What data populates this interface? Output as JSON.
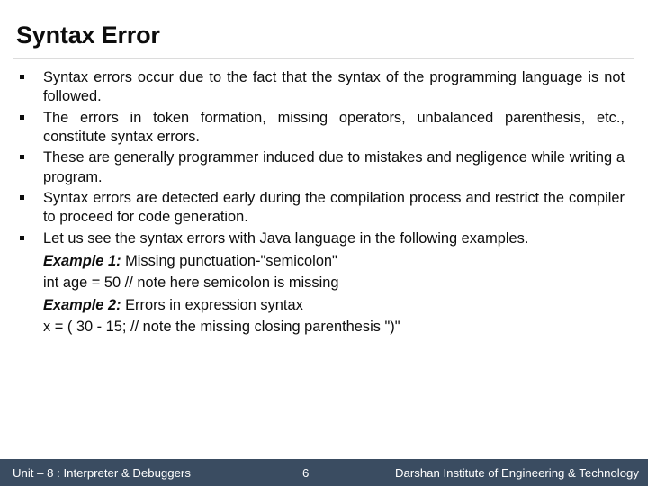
{
  "slide": {
    "title": "Syntax Error",
    "bullets": [
      "Syntax errors occur due to the fact that the syntax of the programming language is not followed.",
      "The errors in token formation, missing operators, unbalanced parenthesis, etc., constitute syntax errors.",
      "These are generally programmer induced due to mistakes and negligence while writing a program.",
      "Syntax errors are detected early during the compilation process and restrict the compiler to proceed for code generation.",
      "Let us see the syntax errors with Java language in the following examples."
    ],
    "sub_lines": [
      {
        "lead": "Example 1:",
        "text": " Missing punctuation-\"semicolon\""
      },
      {
        "lead": "",
        "text": "int age = 50  // note here semicolon is missing"
      },
      {
        "lead": "Example 2:",
        "text": " Errors in expression syntax"
      },
      {
        "lead": "",
        "text": "x = ( 30 - 15; // note the missing closing parenthesis \")\""
      }
    ]
  },
  "footer": {
    "unit": "Unit – 8 : Interpreter & Debuggers",
    "page_number": "6",
    "institute": "Darshan Institute of Engineering & Technology",
    "background_color": "#3a4c61",
    "text_color": "#ffffff"
  }
}
